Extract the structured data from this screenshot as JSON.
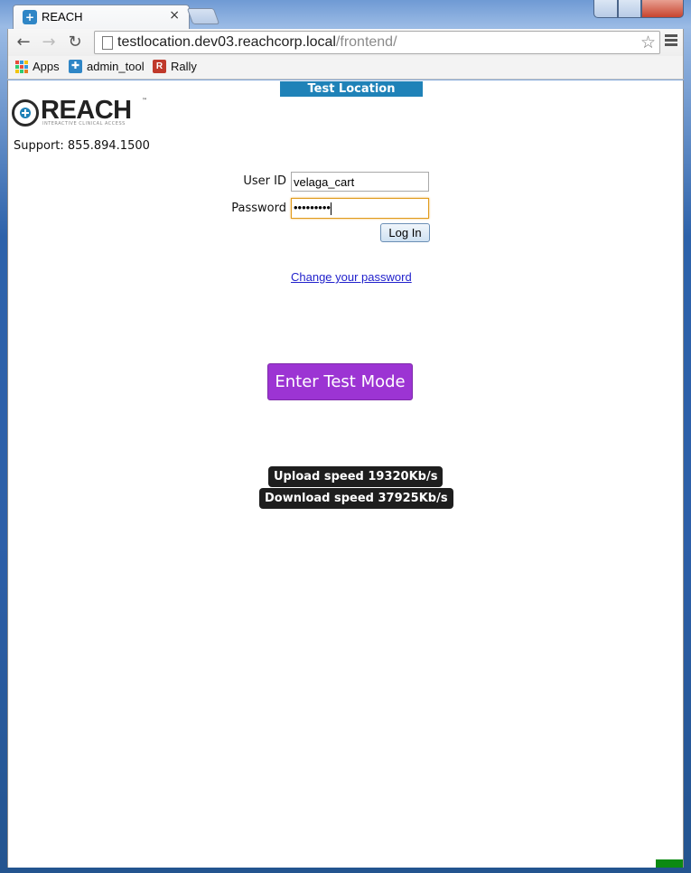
{
  "browser": {
    "tab_title": "REACH",
    "tab_close": "×",
    "url_host": "testlocation.dev03.reachcorp.local",
    "url_path": "/frontend/",
    "bookmarks": [
      {
        "label": "Apps",
        "icon": "apps-grid-icon"
      },
      {
        "label": "admin_tool",
        "icon": "admin-tool-icon"
      },
      {
        "label": "Rally",
        "icon": "rally-icon"
      }
    ]
  },
  "page": {
    "environment_banner": "Test Location (dev03)",
    "logo_text": "REACH",
    "logo_tm": "™",
    "logo_tagline": "INTERACTIVE CLINICAL ACCESS",
    "support_text": "Support: 855.894.1500"
  },
  "login_form": {
    "user_id_label": "User ID",
    "user_id_value": "velaga_cart",
    "password_label": "Password",
    "password_value": "•••••••••",
    "login_button": "Log In",
    "change_password_link": "Change your password"
  },
  "test_mode_button": "Enter Test Mode",
  "speed": {
    "upload": "Upload speed 19320Kb/s",
    "download": "Download speed 37925Kb/s"
  },
  "colors": {
    "banner": "#1f82b8",
    "test_mode_button": "#9c34d3",
    "status_indicator": "#0c8a12"
  }
}
